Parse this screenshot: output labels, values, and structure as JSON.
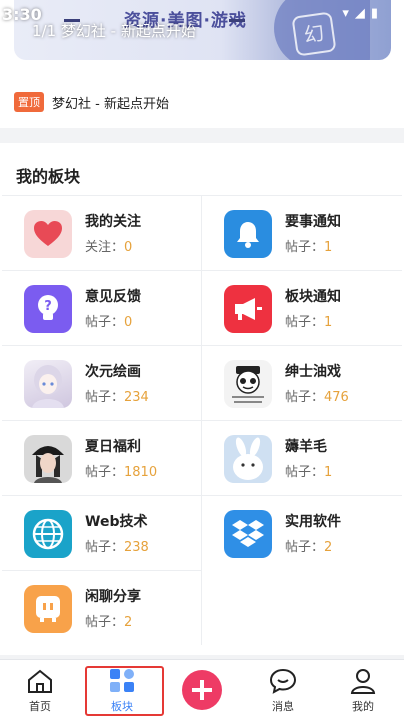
{
  "status_bar": {
    "time": "3:30"
  },
  "banner": {
    "caption": "1/1 梦幻社 - 新起点开始",
    "art_text": "资源·美图·游戏",
    "badge_char": "幻"
  },
  "notice": {
    "tag": "置顶",
    "text": "梦幻社 - 新起点开始"
  },
  "section": {
    "title": "我的板块",
    "boards": [
      {
        "name": "我的关注",
        "stat_label": "关注：",
        "count": "0",
        "icon": "heart-icon",
        "color": "#f7d7d7"
      },
      {
        "name": "要事通知",
        "stat_label": "帖子：",
        "count": "1",
        "icon": "bell-icon",
        "color": "#2a8de0"
      },
      {
        "name": "意见反馈",
        "stat_label": "帖子：",
        "count": "0",
        "icon": "lightbulb-icon",
        "color": "#7b5cf0"
      },
      {
        "name": "板块通知",
        "stat_label": "帖子：",
        "count": "1",
        "icon": "megaphone-icon",
        "color": "#ee3140"
      },
      {
        "name": "次元绘画",
        "stat_label": "帖子：",
        "count": "234",
        "icon": "anime-girl-avatar",
        "color": "#e8e2ef"
      },
      {
        "name": "绅士油戏",
        "stat_label": "帖子：",
        "count": "476",
        "icon": "meme-panda-avatar",
        "color": "#f3f3f3"
      },
      {
        "name": "夏日福利",
        "stat_label": "帖子：",
        "count": "1810",
        "icon": "girl-photo-avatar",
        "color": "#d9d9d9"
      },
      {
        "name": "薅羊毛",
        "stat_label": "帖子：",
        "count": "1",
        "icon": "rabbit-avatar",
        "color": "#cfe0f2"
      },
      {
        "name": "Web技术",
        "stat_label": "帖子：",
        "count": "238",
        "icon": "globe-icon",
        "color": "#1aa3c9"
      },
      {
        "name": "实用软件",
        "stat_label": "帖子：",
        "count": "2",
        "icon": "dropbox-icon",
        "color": "#2f8fe6"
      },
      {
        "name": "闲聊分享",
        "stat_label": "帖子：",
        "count": "2",
        "icon": "chat-bubble-icon",
        "color": "#f8a24a"
      }
    ]
  },
  "tabbar": {
    "tabs": [
      {
        "label": "首页",
        "icon": "home-icon"
      },
      {
        "label": "板块",
        "icon": "grid-icon",
        "active": true
      },
      {
        "label": "",
        "icon": "plus-icon"
      },
      {
        "label": "消息",
        "icon": "message-icon"
      },
      {
        "label": "我的",
        "icon": "profile-icon"
      }
    ],
    "accent": "#3b82f6",
    "highlight": "#e53935"
  }
}
